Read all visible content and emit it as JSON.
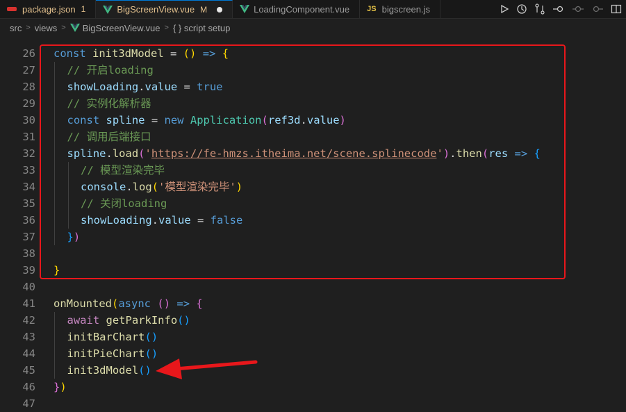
{
  "tabs": [
    {
      "label": "package.json",
      "badge": "1",
      "icon": "json-file-icon",
      "active": false
    },
    {
      "label": "BigScreenView.vue",
      "badge": "M",
      "icon": "vue-file-icon",
      "active": true,
      "dirty": true
    },
    {
      "label": "LoadingComponent.vue",
      "icon": "vue-file-icon",
      "active": false
    },
    {
      "label": "bigscreen.js",
      "icon_text": "JS",
      "active": false
    }
  ],
  "breadcrumb": {
    "parts": [
      "src",
      "views",
      "BigScreenView.vue",
      "{ } script setup"
    ]
  },
  "colors": {
    "highlight_box": "#e8171b",
    "arrow": "#e8171b",
    "background": "#1f1f1f"
  },
  "lines": [
    {
      "n": "26",
      "indent": 0,
      "tokens": [
        [
          "kw",
          "const"
        ],
        [
          "txt",
          " "
        ],
        [
          "fn",
          "init3dModel"
        ],
        [
          "txt",
          " = "
        ],
        [
          "p1",
          "()"
        ],
        [
          "txt",
          " "
        ],
        [
          "kw",
          "=>"
        ],
        [
          "txt",
          " "
        ],
        [
          "p1",
          "{"
        ]
      ]
    },
    {
      "n": "27",
      "indent": 1,
      "tokens": [
        [
          "cmt",
          "// 开启loading"
        ]
      ]
    },
    {
      "n": "28",
      "indent": 1,
      "tokens": [
        [
          "var",
          "showLoading"
        ],
        [
          "txt",
          "."
        ],
        [
          "var",
          "value"
        ],
        [
          "txt",
          " = "
        ],
        [
          "kw",
          "true"
        ]
      ]
    },
    {
      "n": "29",
      "indent": 1,
      "tokens": [
        [
          "cmt",
          "// 实例化解析器"
        ]
      ]
    },
    {
      "n": "30",
      "indent": 1,
      "tokens": [
        [
          "kw",
          "const"
        ],
        [
          "txt",
          " "
        ],
        [
          "var",
          "spline"
        ],
        [
          "txt",
          " = "
        ],
        [
          "kw",
          "new"
        ],
        [
          "txt",
          " "
        ],
        [
          "cls",
          "Application"
        ],
        [
          "p2",
          "("
        ],
        [
          "var",
          "ref3d"
        ],
        [
          "txt",
          "."
        ],
        [
          "var",
          "value"
        ],
        [
          "p2",
          ")"
        ]
      ]
    },
    {
      "n": "31",
      "indent": 1,
      "tokens": [
        [
          "cmt",
          "// 调用后端接口"
        ]
      ]
    },
    {
      "n": "32",
      "indent": 1,
      "tokens": [
        [
          "var",
          "spline"
        ],
        [
          "txt",
          "."
        ],
        [
          "fn",
          "load"
        ],
        [
          "p2",
          "("
        ],
        [
          "str",
          "'"
        ],
        [
          "url",
          "https://fe-hmzs.itheima.net/scene.splinecode"
        ],
        [
          "str",
          "'"
        ],
        [
          "p2",
          ")"
        ],
        [
          "txt",
          "."
        ],
        [
          "fn",
          "then"
        ],
        [
          "p2",
          "("
        ],
        [
          "var",
          "res"
        ],
        [
          "txt",
          " "
        ],
        [
          "kw",
          "=>"
        ],
        [
          "txt",
          " "
        ],
        [
          "p3",
          "{"
        ]
      ]
    },
    {
      "n": "33",
      "indent": 2,
      "tokens": [
        [
          "cmt",
          "// 模型渲染完毕"
        ]
      ]
    },
    {
      "n": "34",
      "indent": 2,
      "tokens": [
        [
          "var",
          "console"
        ],
        [
          "txt",
          "."
        ],
        [
          "fn",
          "log"
        ],
        [
          "p1",
          "("
        ],
        [
          "str",
          "'模型渲染完毕'"
        ],
        [
          "p1",
          ")"
        ]
      ]
    },
    {
      "n": "35",
      "indent": 2,
      "tokens": [
        [
          "cmt",
          "// 关闭loading"
        ]
      ]
    },
    {
      "n": "36",
      "indent": 2,
      "tokens": [
        [
          "var",
          "showLoading"
        ],
        [
          "txt",
          "."
        ],
        [
          "var",
          "value"
        ],
        [
          "txt",
          " = "
        ],
        [
          "kw",
          "false"
        ]
      ]
    },
    {
      "n": "37",
      "indent": 1,
      "tokens": [
        [
          "p3",
          "}"
        ],
        [
          "p2",
          ")"
        ]
      ]
    },
    {
      "n": "38",
      "indent": 0,
      "tokens": []
    },
    {
      "n": "39",
      "indent": 0,
      "tokens": [
        [
          "p1",
          "}"
        ]
      ]
    },
    {
      "n": "40",
      "indent": 0,
      "tokens": []
    },
    {
      "n": "41",
      "indent": 0,
      "tokens": [
        [
          "fn",
          "onMounted"
        ],
        [
          "p1",
          "("
        ],
        [
          "kw",
          "async"
        ],
        [
          "txt",
          " "
        ],
        [
          "p2",
          "()"
        ],
        [
          "txt",
          " "
        ],
        [
          "kw",
          "=>"
        ],
        [
          "txt",
          " "
        ],
        [
          "p2",
          "{"
        ]
      ]
    },
    {
      "n": "42",
      "indent": 1,
      "tokens": [
        [
          "kw2",
          "await"
        ],
        [
          "txt",
          " "
        ],
        [
          "fn",
          "getParkInfo"
        ],
        [
          "p3",
          "()"
        ]
      ]
    },
    {
      "n": "43",
      "indent": 1,
      "tokens": [
        [
          "fn",
          "initBarChart"
        ],
        [
          "p3",
          "()"
        ]
      ]
    },
    {
      "n": "44",
      "indent": 1,
      "tokens": [
        [
          "fn",
          "initPieChart"
        ],
        [
          "p3",
          "()"
        ]
      ]
    },
    {
      "n": "45",
      "indent": 1,
      "tokens": [
        [
          "fn",
          "init3dModel"
        ],
        [
          "p3",
          "()"
        ]
      ]
    },
    {
      "n": "46",
      "indent": 0,
      "tokens": [
        [
          "p2",
          "}"
        ],
        [
          "p1",
          ")"
        ]
      ]
    },
    {
      "n": "47",
      "indent": 0,
      "tokens": []
    }
  ]
}
